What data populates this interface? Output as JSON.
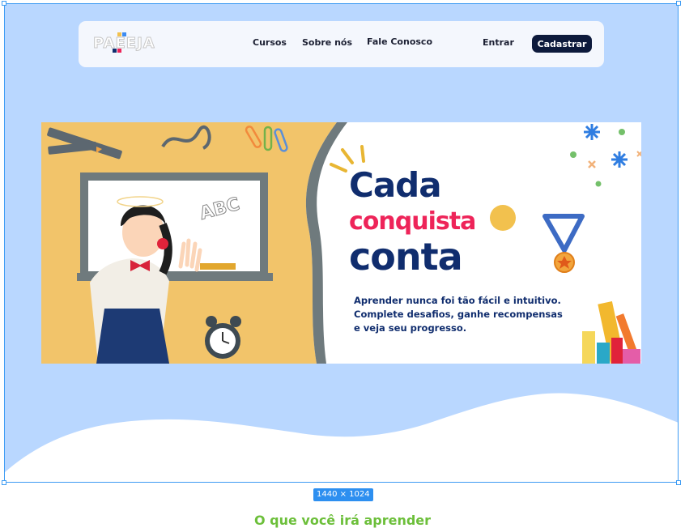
{
  "navbar": {
    "logo_text": "PAEEJA",
    "links": [
      "Cursos",
      "Sobre nós",
      "Fale Conosco"
    ],
    "login_label": "Entrar",
    "signup_label": "Cadastrar"
  },
  "hero": {
    "headline_line1": "Cada",
    "headline_line2": "conquista",
    "headline_line3": "conta",
    "subtext_line1": "Aprender nunca foi tão fácil e intuitivo.",
    "subtext_line2": "Complete desafios, ganhe recompensas",
    "subtext_line3": "e veja seu progresso.",
    "board_text": "ABC",
    "accent_colors": {
      "navy": "#102d6e",
      "pink": "#ee2459",
      "yellow": "#f2c14e",
      "board": "#6f7a7d"
    }
  },
  "canvas": {
    "size_label": "1440 × 1024"
  },
  "next_section": {
    "title": "O que você irá aprender"
  }
}
